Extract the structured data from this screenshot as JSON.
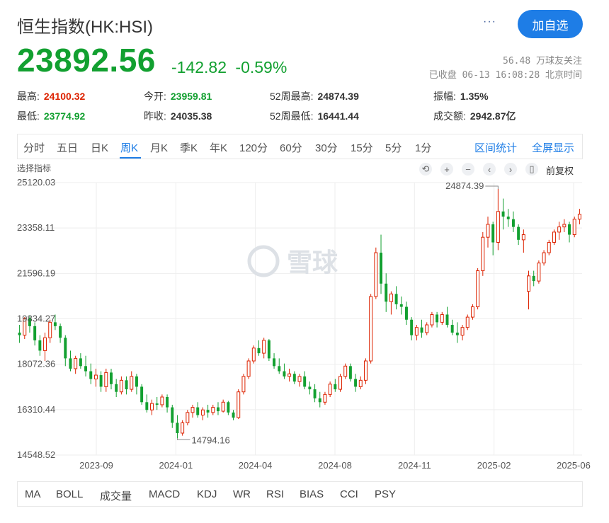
{
  "header": {
    "title": "恒生指数(HK:HSI)",
    "more_label": "···",
    "add_button": "加自选"
  },
  "quote": {
    "price": "23892.56",
    "change": "-142.82",
    "change_pct": "-0.59%",
    "followers": "56.48 万球友关注",
    "status": "已收盘 06-13 16:08:28 北京时间"
  },
  "stats": [
    {
      "label": "最高:",
      "value": "24100.32",
      "color": "red"
    },
    {
      "label": "今开:",
      "value": "23959.81",
      "color": "green"
    },
    {
      "label": "52周最高:",
      "value": "24874.39",
      "color": "none"
    },
    {
      "label": "振幅:",
      "value": "1.35%",
      "color": "none"
    },
    {
      "label": "最低:",
      "value": "23774.92",
      "color": "green"
    },
    {
      "label": "昨收:",
      "value": "24035.38",
      "color": "none"
    },
    {
      "label": "52周最低:",
      "value": "16441.44",
      "color": "none"
    },
    {
      "label": "成交额:",
      "value": "2942.87亿",
      "color": "none"
    }
  ],
  "period_tabs": [
    "分时",
    "五日",
    "日K",
    "周K",
    "月K",
    "季K",
    "年K",
    "120分",
    "60分",
    "30分",
    "15分",
    "5分",
    "1分"
  ],
  "active_tab": "周K",
  "tab_actions": {
    "range_stats": "区间统计",
    "fullscreen": "全屏显示"
  },
  "chart_toolbar": {
    "select_indicator": "选择指标",
    "icons": [
      "undo-icon",
      "zoom-in-icon",
      "zoom-out-icon",
      "scroll-left-icon",
      "scroll-right-icon",
      "candle-style-icon"
    ],
    "adjust_label": "前复权"
  },
  "watermark": "雪球",
  "colors": {
    "up": "#dd2200",
    "down": "#12a030",
    "accent": "#1e7de6"
  },
  "chart_data": {
    "type": "candlestick",
    "title": "",
    "y_ticks": [
      "25120.03",
      "23358.11",
      "21596.19",
      "19834.27",
      "18072.36",
      "16310.44",
      "14548.52"
    ],
    "x_ticks": [
      "2023-09",
      "2024-01",
      "2024-04",
      "2024-08",
      "2024-11",
      "2025-02",
      "2025-06"
    ],
    "ylim": [
      14548.52,
      25120.03
    ],
    "annotations": [
      {
        "label": "24874.39",
        "kind": "max"
      },
      {
        "label": "14794.16",
        "kind": "min"
      }
    ],
    "candles": [
      [
        19300,
        19600,
        18900,
        19200
      ],
      [
        19200,
        19900,
        19050,
        19850
      ],
      [
        19850,
        19950,
        19300,
        19550
      ],
      [
        19550,
        19700,
        18800,
        19000
      ],
      [
        19000,
        19200,
        18400,
        18600
      ],
      [
        18600,
        19300,
        18200,
        19100
      ],
      [
        19100,
        19800,
        18900,
        19700
      ],
      [
        19700,
        20000,
        19400,
        19550
      ],
      [
        19550,
        19650,
        18900,
        19100
      ],
      [
        19100,
        19200,
        18000,
        18300
      ],
      [
        18300,
        18600,
        17800,
        17900
      ],
      [
        17900,
        18400,
        17700,
        18300
      ],
      [
        18300,
        18500,
        17900,
        18000
      ],
      [
        18000,
        18400,
        17600,
        17800
      ],
      [
        17800,
        18100,
        17300,
        17500
      ],
      [
        17500,
        17900,
        17200,
        17650
      ],
      [
        17650,
        17800,
        17000,
        17200
      ],
      [
        17200,
        17900,
        17000,
        17750
      ],
      [
        17750,
        17900,
        17100,
        17300
      ],
      [
        17300,
        17500,
        16800,
        17000
      ],
      [
        17000,
        17600,
        16900,
        17450
      ],
      [
        17450,
        17600,
        16900,
        17100
      ],
      [
        17100,
        17800,
        17000,
        17600
      ],
      [
        17600,
        17700,
        16900,
        17200
      ],
      [
        17200,
        17300,
        16500,
        16600
      ],
      [
        16600,
        16900,
        16200,
        16300
      ],
      [
        16300,
        16700,
        16100,
        16550
      ],
      [
        16550,
        16800,
        16300,
        16500
      ],
      [
        16500,
        16900,
        16400,
        16800
      ],
      [
        16800,
        16900,
        16200,
        16400
      ],
      [
        16400,
        16500,
        15600,
        15800
      ],
      [
        15800,
        16100,
        15200,
        15400
      ],
      [
        15400,
        15900,
        15300,
        15800
      ],
      [
        15800,
        16300,
        15700,
        16200
      ],
      [
        16200,
        16500,
        16000,
        16400
      ],
      [
        16400,
        16600,
        16000,
        16100
      ],
      [
        16100,
        16400,
        15900,
        16300
      ],
      [
        16300,
        16500,
        16000,
        16200
      ],
      [
        16200,
        16500,
        16100,
        16400
      ],
      [
        16400,
        16600,
        16100,
        16250
      ],
      [
        16250,
        16700,
        16200,
        16600
      ],
      [
        16600,
        16650,
        16100,
        16200
      ],
      [
        16200,
        16300,
        15900,
        16000
      ],
      [
        16000,
        17100,
        15950,
        17000
      ],
      [
        17000,
        17700,
        16900,
        17600
      ],
      [
        17600,
        18300,
        17500,
        18200
      ],
      [
        18200,
        18800,
        18100,
        18700
      ],
      [
        18700,
        19000,
        18400,
        18500
      ],
      [
        18500,
        19100,
        18300,
        19000
      ],
      [
        19000,
        19050,
        18200,
        18300
      ],
      [
        18300,
        18500,
        17900,
        18000
      ],
      [
        18000,
        18300,
        17700,
        17800
      ],
      [
        17800,
        18100,
        17500,
        17600
      ],
      [
        17600,
        17900,
        17400,
        17700
      ],
      [
        17700,
        17800,
        17300,
        17400
      ],
      [
        17400,
        17700,
        17200,
        17600
      ],
      [
        17600,
        17800,
        17100,
        17200
      ],
      [
        17200,
        17400,
        16900,
        17100
      ],
      [
        17100,
        17300,
        16600,
        16750
      ],
      [
        16750,
        17000,
        16400,
        16600
      ],
      [
        16600,
        17000,
        16500,
        16900
      ],
      [
        16900,
        17400,
        16800,
        17300
      ],
      [
        17300,
        17500,
        17000,
        17100
      ],
      [
        17100,
        17700,
        17000,
        17600
      ],
      [
        17600,
        18100,
        17500,
        18000
      ],
      [
        18000,
        18100,
        17400,
        17500
      ],
      [
        17500,
        17700,
        17000,
        17200
      ],
      [
        17200,
        17600,
        17100,
        17450
      ],
      [
        17450,
        18300,
        17300,
        18200
      ],
      [
        18200,
        20800,
        18100,
        20700
      ],
      [
        20700,
        22600,
        20600,
        22400
      ],
      [
        22400,
        23100,
        20800,
        21200
      ],
      [
        21200,
        21600,
        20100,
        20500
      ],
      [
        20500,
        20900,
        20000,
        20800
      ],
      [
        20800,
        21100,
        20200,
        20400
      ],
      [
        20400,
        20700,
        20000,
        20300
      ],
      [
        20300,
        20500,
        19600,
        19800
      ],
      [
        19800,
        19900,
        19000,
        19200
      ],
      [
        19200,
        19600,
        19000,
        19500
      ],
      [
        19500,
        19800,
        19100,
        19300
      ],
      [
        19300,
        19700,
        19200,
        19600
      ],
      [
        19600,
        20100,
        19500,
        20000
      ],
      [
        20000,
        20100,
        19500,
        19700
      ],
      [
        19700,
        20100,
        19600,
        20000
      ],
      [
        20000,
        20300,
        19500,
        19600
      ],
      [
        19600,
        19800,
        19200,
        19300
      ],
      [
        19300,
        19700,
        18900,
        19200
      ],
      [
        19200,
        19600,
        19000,
        19500
      ],
      [
        19500,
        20000,
        19400,
        19900
      ],
      [
        19900,
        20400,
        19800,
        20300
      ],
      [
        20300,
        21800,
        20200,
        21700
      ],
      [
        21700,
        23200,
        21500,
        23000
      ],
      [
        23000,
        23800,
        22600,
        23500
      ],
      [
        23500,
        23600,
        22300,
        22800
      ],
      [
        22800,
        24874,
        22500,
        24000
      ],
      [
        24000,
        24500,
        23300,
        23800
      ],
      [
        23800,
        24100,
        23400,
        23700
      ],
      [
        23700,
        24000,
        23200,
        23400
      ],
      [
        23400,
        23500,
        22700,
        22900
      ],
      [
        22900,
        23300,
        22400,
        23100
      ],
      [
        20900,
        21700,
        20200,
        21500
      ],
      [
        21500,
        21700,
        21100,
        21300
      ],
      [
        21300,
        22100,
        21200,
        22000
      ],
      [
        22000,
        22500,
        21900,
        22400
      ],
      [
        22400,
        22900,
        22300,
        22800
      ],
      [
        22800,
        23300,
        22700,
        23200
      ],
      [
        23200,
        23600,
        22900,
        23400
      ],
      [
        23400,
        23700,
        23200,
        23500
      ],
      [
        23500,
        23600,
        22800,
        23100
      ],
      [
        23100,
        23800,
        23000,
        23700
      ],
      [
        23700,
        24100,
        23500,
        23893
      ]
    ]
  },
  "indicators": [
    "MA",
    "BOLL",
    "成交量",
    "MACD",
    "KDJ",
    "WR",
    "RSI",
    "BIAS",
    "CCI",
    "PSY"
  ]
}
